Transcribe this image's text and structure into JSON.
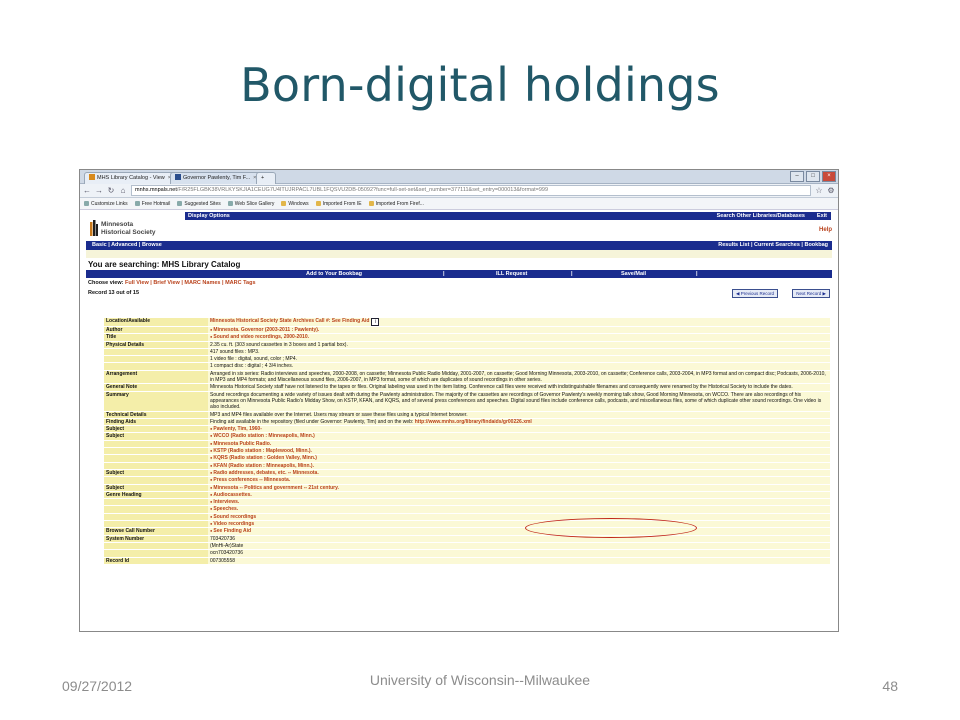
{
  "slide": {
    "title": "Born-digital holdings",
    "footer_date": "09/27/2012",
    "footer_center": "University of Wisconsin--Milwaukee",
    "footer_page": "48"
  },
  "browser": {
    "tabs": [
      {
        "label": "MHS Library Catalog - View",
        "close": "×"
      },
      {
        "label": "Governor Pawlenty, Tim F...",
        "close": "×"
      }
    ],
    "url_host": "mnhs.mnpals.net",
    "url_rest": "/F/R25FLGBK38VRLKYSKJIA1CEUG7U4ITUJRPACL7UBL1FQSVU2DB-05092?func=full-set-set&set_number=377111&set_entry=000013&format=999",
    "bookmarks": [
      "Customize Links",
      "Free Hotmail",
      "Suggested Sites",
      "Web Slice Gallery",
      "Windows",
      "Imported From IE",
      "Imported From Firef..."
    ]
  },
  "catalog": {
    "display_options": "Display Options",
    "search_other": "Search Other Libraries/Databases",
    "exit": "Exit",
    "logo_line1": "Minnesota",
    "logo_line2": "Historical Society",
    "help": "Help",
    "nav_left": "Basic  |  Advanced  |  Browse",
    "nav_right": "Results List  |  Current Searches  |  Bookbag",
    "searching": "You are searching: MHS Library Catalog",
    "add_bookbag": "Add to Your Bookbag",
    "ill_request": "ILL Request",
    "save_mail": "Save/Mail",
    "choose_view_label": "Choose view:",
    "choose_view_links": "Full View  |  Brief View  |  MARC Names  |  MARC Tags",
    "record_of": "Record 13 out of 15",
    "prev_record": "◀ Previous Record",
    "next_record": "Next Record ▶"
  },
  "record": {
    "location_label": "Location/Available",
    "location_value": "Minnesota Historical Society State Archives Call #: See Finding Aid",
    "author_label": "Author",
    "author_value": "Minnesota. Governor (2003-2011 : Pawlenty).",
    "title_label": "Title",
    "title_value": "Sound and video recordings, 2000-2010.",
    "physical_label": "Physical Details",
    "physical_1": "2.35 cu. ft. (303 sound cassettes in 3 boxes and 1 partial box).",
    "physical_2": "417 sound files : MP3.",
    "physical_3": "1 video file : digital, sound, color ; MP4.",
    "physical_4": "1 compact disc : digital ; 4 3/4 inches.",
    "arrangement_label": "Arrangement",
    "arrangement_value": "Arranged in six series: Radio interviews and speeches, 2000-2008, on cassette; Minnesota Public Radio Midday, 2001-2007, on cassette; Good Morning Minnesota, 2003-2010, on cassette; Conference calls, 2003-2004, in MP3 format and on compact disc; Podcasts, 2006-2010, in MP3 and MP4 formats; and Miscellaneous sound files, 2006-2007, in MP3 format, some of which are duplicates of sound recordings in other series.",
    "general_label": "General Note",
    "general_value": "Minnesota Historical Society staff have not listened to the tapes or files. Original labeling was used in the item listing. Conference call files were received with indistinguishable filenames and consequently were renamed by the Historical Society to include the dates.",
    "summary_label": "Summary",
    "summary_value": "Sound recordings documenting a wide variety of issues dealt with during the Pawlenty administration. The majority of the cassettes are recordings of Governor Pawlenty's weekly morning talk show, Good Morning Minnesota, on WCCO. There are also recordings of his appearances on Minnesota Public Radio's Midday Show, on KSTP, KFAN, and KQRS, and of several press conferences and speeches. Digital sound files include conference calls, podcasts, and miscellaneous files, some of which duplicate other sound recordings. One video is also included.",
    "technical_label": "Technical Details",
    "technical_value": "MP3 and MP4 files available over the Internet. Users may stream or save these files using a typical Internet browser.",
    "finding_label": "Finding Aids",
    "finding_value": "Finding aid available in the repository (filed under Governor: Pawlenty, Tim) and on the web:",
    "finding_link": "http://www.mnhs.org/library/findaids/gr00226.xml",
    "subject_label": "Subject",
    "subject_1": "Pawlenty, Tim, 1960-",
    "subject_list_1": [
      "WCCO (Radio station : Minneapolis, Minn.)",
      "Minnesota Public Radio.",
      "KSTP (Radio station : Maplewood, Minn.).",
      "KQRS (Radio station : Golden Valley, Minn.)",
      "KFAN (Radio station : Minneapolis, Minn.)."
    ],
    "subject_list_2": [
      "Radio addresses, debates, etc. -- Minnesota.",
      "Press conferences -- Minnesota."
    ],
    "subject_3": "Minnesota -- Politics and government -- 21st century.",
    "genre_label": "Genre Heading",
    "genre_list": [
      "Audiocassettes.",
      "Interviews.",
      "Speeches.",
      "Sound recordings",
      "Video recordings"
    ],
    "browse_label": "Browse Call Number",
    "browse_value": "See Finding Aid",
    "system_label": "System Number",
    "system_1": "703420736",
    "system_2": "(MnHi-Ar)State",
    "system_3": "ocn703420736",
    "recordid_label": "Record Id",
    "recordid_value": "007305558"
  },
  "colors": {
    "title": "#215868",
    "navy": "#1a2c8e",
    "link": "#b9421c",
    "label_bg": "#f4eea9",
    "value_bg": "#fbf9d6",
    "highlight": "#c0281b"
  }
}
